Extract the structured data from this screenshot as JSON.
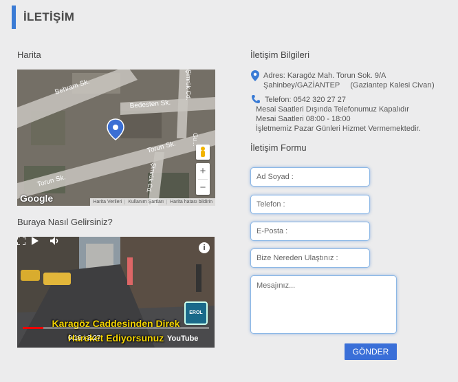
{
  "header": {
    "title": "İLETİŞİM"
  },
  "sections": {
    "map_title": "Harita",
    "directions_title": "Buraya Nasıl Gelirsiniz?",
    "contact_info_title": "İletişim Bilgileri",
    "contact_form_title": "İletişim Formu"
  },
  "map": {
    "streets": [
      "Behram Sk.",
      "Bedesten Sk.",
      "Torun Sk.",
      "Torun Sk.",
      "Şimrük Cd.",
      "Şimrük Cd.",
      "Gu..."
    ],
    "logo": "Google",
    "footer_links": [
      "Harita Verileri",
      "Kullanım Şartları",
      "Harita hatası bildirin"
    ],
    "zoom_in": "+",
    "zoom_out": "−",
    "pin_icon": "map-pin-icon"
  },
  "video": {
    "caption_line1": "Karagöz Caddesinden Direk",
    "caption_line2": "Hareket Ediyorsunuz",
    "time": "0:16 / 2:27",
    "progress": 0.11,
    "youtube": "YouTube",
    "channel_badge": "EROL",
    "info": "i"
  },
  "contact": {
    "address_line1": "Adres: Karagöz Mah. Torun Sok. 9/A",
    "address_line2": "Şahinbey/GAZİANTEP     (Gaziantep Kalesi Civarı)",
    "phone": "Telefon: 0542 320 27 27",
    "hours_line1": "Mesai Saatleri Dışında Telefonumuz Kapalıdır",
    "hours_line2": "Mesai Saatleri 08:00 - 18:00",
    "hours_line3": "İşletmemiz Pazar Günleri Hizmet Vermemektedir.",
    "accent_color": "#3a7bd5"
  },
  "form": {
    "name_placeholder": "Ad Soyad :",
    "phone_placeholder": "Telefon :",
    "email_placeholder": "E-Posta :",
    "source_placeholder": "Bize Nereden Ulaştınız :",
    "message_placeholder": "Mesajınız...",
    "submit_label": "GÖNDER"
  }
}
